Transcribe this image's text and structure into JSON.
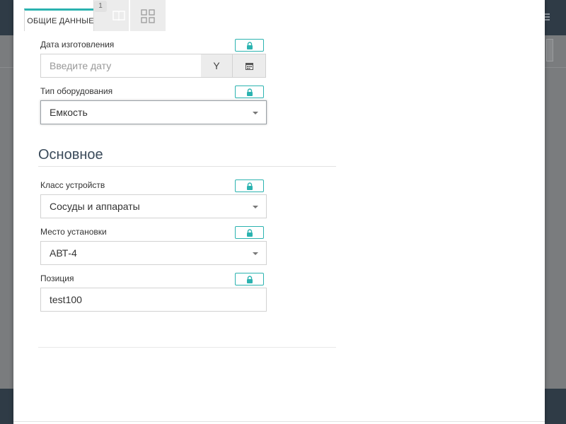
{
  "tabs": {
    "main_label": "ОБЩИЕ ДАННЫЕ",
    "badge_count": "1",
    "icon_tab_1": "book-icon",
    "icon_tab_2": "grid-icon"
  },
  "form": {
    "manufacture_date": {
      "label": "Дата изготовления",
      "placeholder": "Введите дату",
      "value": "",
      "format_button": "Y",
      "calendar_icon": "calendar-icon"
    },
    "equipment_type": {
      "label": "Тип оборудования",
      "value": "Емкость"
    }
  },
  "section": {
    "title": "Основное",
    "device_class": {
      "label": "Класс устройств",
      "value": "Сосуды и аппараты"
    },
    "install_place": {
      "label": "Место установки",
      "value": "АВТ-4"
    },
    "position": {
      "label": "Позиция",
      "value": "test100"
    }
  },
  "colors": {
    "accent": "#2bb3b0",
    "header_dark": "#2f3b46",
    "section_title": "#3a4a5a"
  },
  "lock_icon": "lock-icon"
}
